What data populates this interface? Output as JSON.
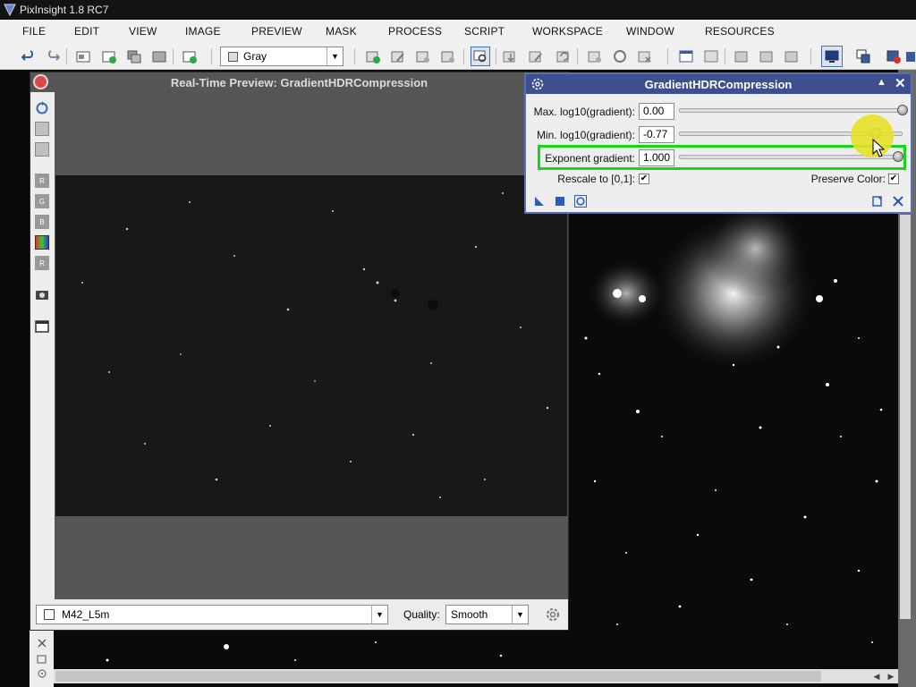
{
  "app": {
    "title": "PixInsight 1.8 RC7"
  },
  "menu": [
    "FILE",
    "EDIT",
    "VIEW",
    "IMAGE",
    "PREVIEW",
    "MASK",
    "PROCESS",
    "SCRIPT",
    "WORKSPACE",
    "WINDOW",
    "RESOURCES"
  ],
  "toolbar": {
    "color_space": "Gray"
  },
  "preview_window": {
    "title": "Real-Time Preview: GradientHDRCompression",
    "channel_buttons": [
      "R",
      "G",
      "B",
      "R"
    ],
    "view_selector": "M42_L5m",
    "quality_label": "Quality:",
    "quality_value": "Smooth"
  },
  "dialog": {
    "title": "GradientHDRCompression",
    "max_label": "Max. log10(gradient):",
    "max_value": "0.00",
    "min_label": "Min. log10(gradient):",
    "min_value": "-0.77",
    "exp_label": "Exponent gradient:",
    "exp_value": "1.000",
    "rescale_label": "Rescale to [0,1]:",
    "rescale_checked": true,
    "preserve_label": "Preserve Color:",
    "preserve_checked": true,
    "max_slider_fraction": 1.0,
    "min_slider_fraction": 0.88,
    "exp_slider_fraction": 0.98
  },
  "colors": {
    "dialog_title_bg": "#3d4f8f",
    "highlight": "#18d418",
    "cursor_halo": "#e6e128"
  }
}
